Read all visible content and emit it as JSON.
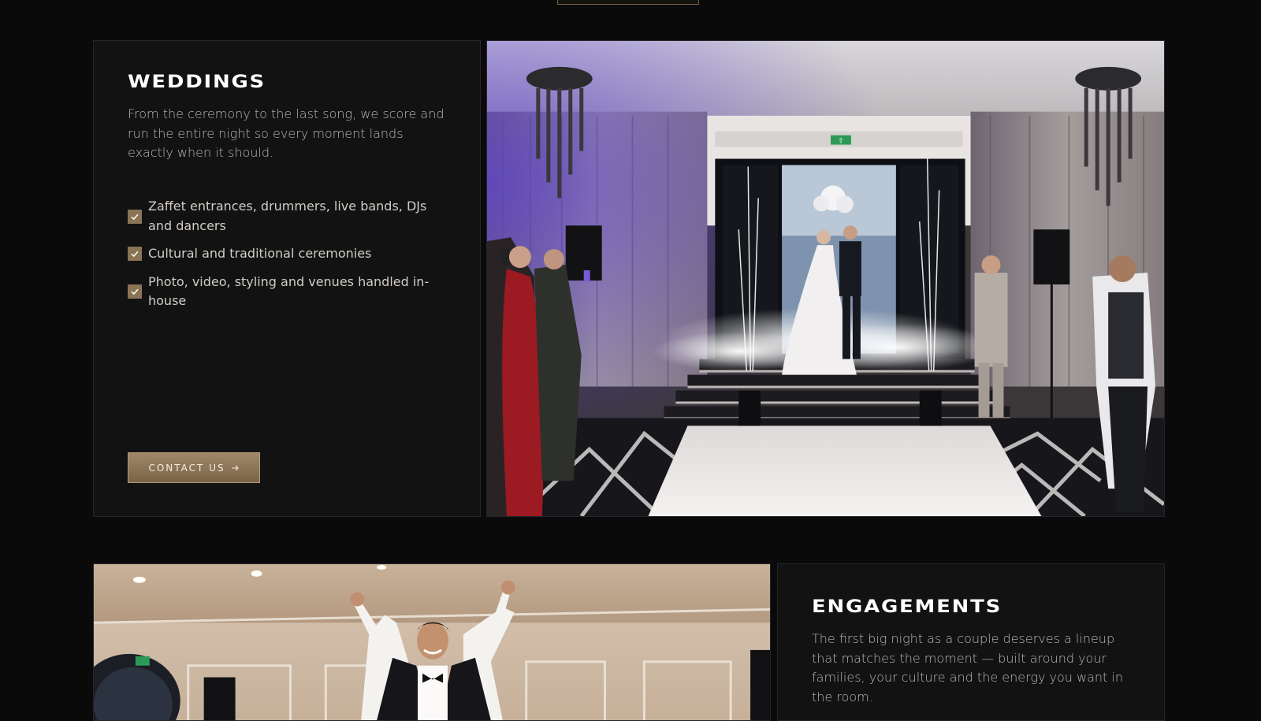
{
  "weddings": {
    "title": "WEDDINGS",
    "description": "From the ceremony to the last song, we score and run the entire night so every moment lands exactly when it should.",
    "features": [
      "Zaffet entrances, drummers, live bands, DJs and dancers",
      "Cultural and traditional ceremonies",
      "Photo, video, styling and venues handled in-house"
    ],
    "cta_label": "CONTACT US",
    "cta_icon": "arrow-right-icon",
    "image_exit_sign": "⇧"
  },
  "engagements": {
    "title": "ENGAGEMENTS",
    "description": "The first big night as a couple deserves a lineup that matches the moment — built around your families, your culture and the energy you want in the room."
  },
  "colors": {
    "page_bg": "#0a0a0b",
    "card_bg": "#121213",
    "accent_gold": "#8a7455",
    "heading": "#ffffff",
    "body_text": "#bdb8b0"
  }
}
